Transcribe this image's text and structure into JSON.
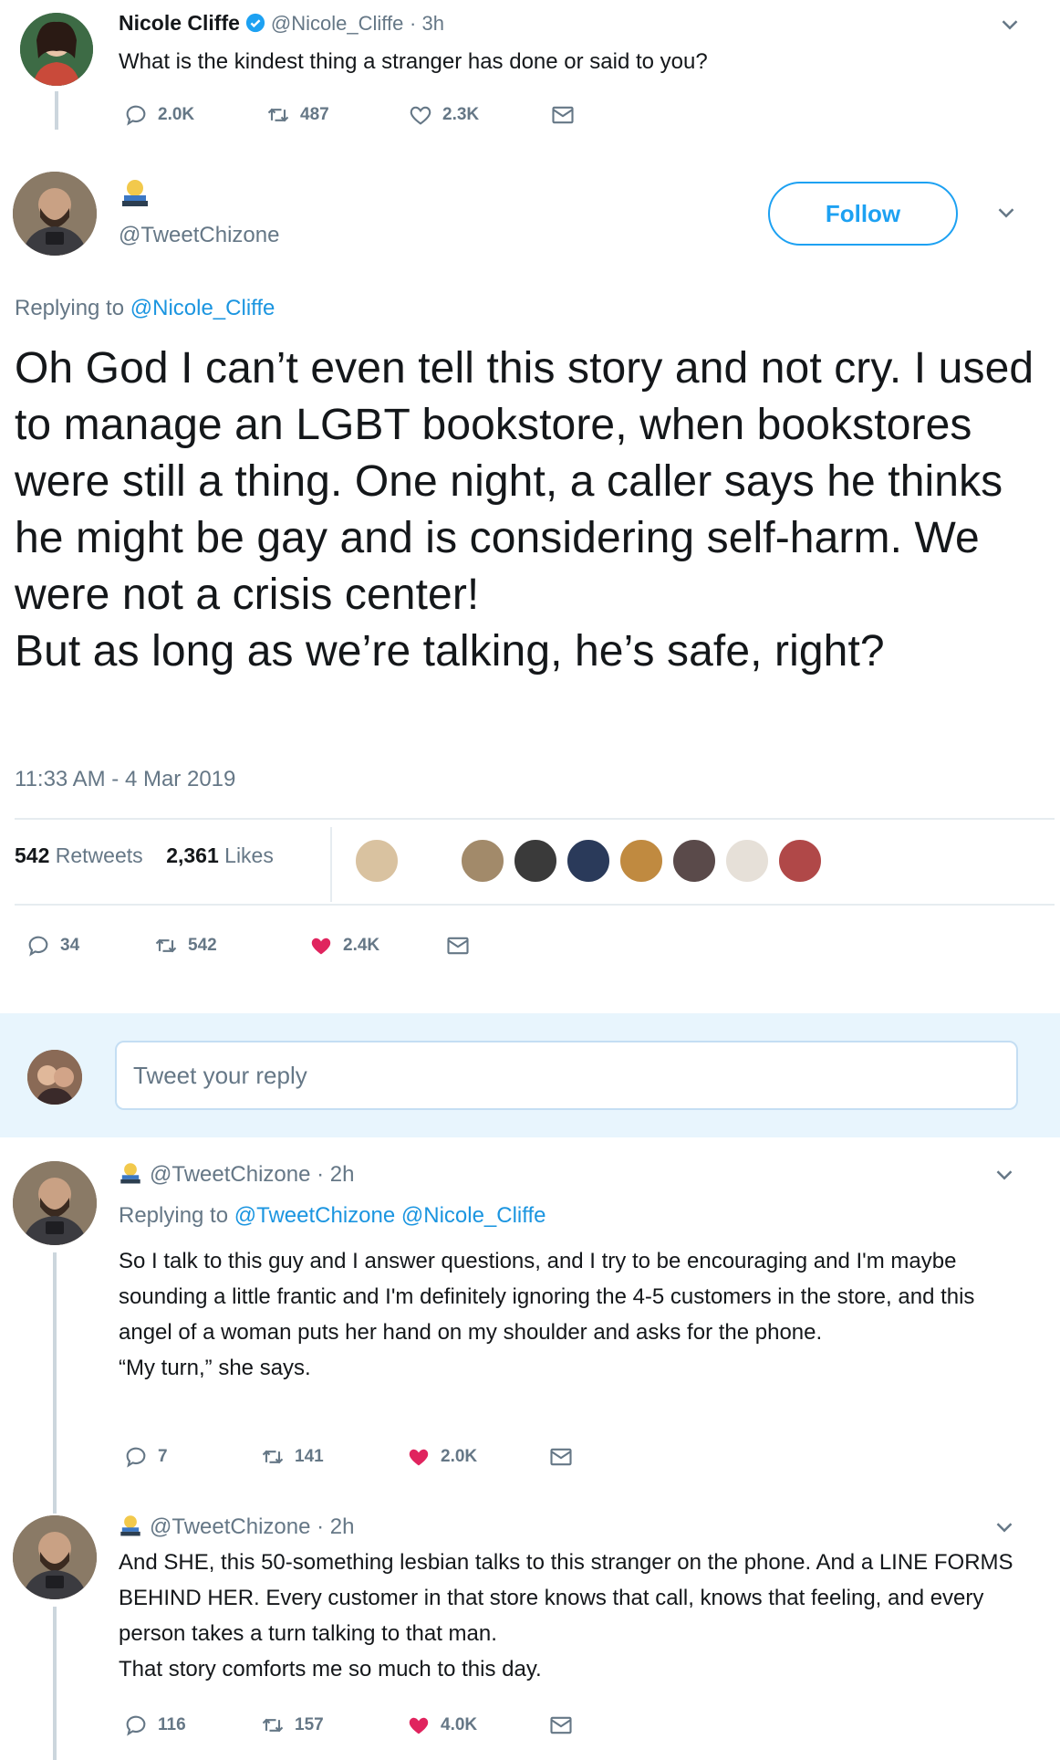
{
  "tweet1": {
    "name": "Nicole Cliffe",
    "handle": "@Nicole_Cliffe",
    "time": "· 3h",
    "text": "What is the kindest thing a stranger has done or said to you?",
    "replies": "2.0K",
    "retweets": "487",
    "likes": "2.3K"
  },
  "tweet2": {
    "handle": "@TweetChizone",
    "follow_label": "Follow",
    "replying_prefix": "Replying to",
    "replying_to": "@Nicole_Cliffe",
    "paragraph1": "Oh God I can’t even tell this story and not cry. I used to manage an LGBT bookstore, when bookstores were still a thing. One night, a caller says he thinks he might be gay and is considering self-harm. We were not a crisis center!",
    "paragraph2": "But as long as we’re talking, he’s safe, right?",
    "timestamp": "11:33 AM - 4 Mar 2019",
    "retweet_count": "542",
    "retweet_label": "Retweets",
    "like_count": "2,361",
    "like_label": "Likes",
    "replies": "34",
    "retweets": "542",
    "likes": "2.4K"
  },
  "reply_box": {
    "placeholder": "Tweet your reply"
  },
  "tweet3": {
    "handle": "@TweetChizone",
    "time": "· 2h",
    "replying_prefix": "Replying to",
    "replying_to": "@TweetChizone @Nicole_Cliffe",
    "paragraph1": "So I talk to this guy and I answer questions, and I try to be encouraging and I'm maybe sounding a little frantic and I'm definitely ignoring the 4-5 customers in the store, and this angel of a woman puts her hand on my shoulder and asks for the phone.",
    "paragraph2": "“My turn,” she says.",
    "replies": "7",
    "retweets": "141",
    "likes": "2.0K"
  },
  "tweet4": {
    "handle": "@TweetChizone",
    "time": "· 2h",
    "paragraph1": "And SHE, this 50-something lesbian talks to this stranger on the phone. And a LINE FORMS BEHIND HER. Every customer in that store knows that call, knows that feeling, and every person takes a turn talking to that man.",
    "paragraph2": "That story comforts me so much to this day.",
    "replies": "116",
    "retweets": "157",
    "likes": "4.0K"
  },
  "colors": {
    "accent": "#1da1f2",
    "like_red": "#e0245e",
    "muted": "#657786",
    "thread_line": "#ccd6dd"
  },
  "icons": [
    "reply-icon",
    "retweet-icon",
    "like-icon",
    "message-icon",
    "chevron-down-icon",
    "verified-icon"
  ]
}
